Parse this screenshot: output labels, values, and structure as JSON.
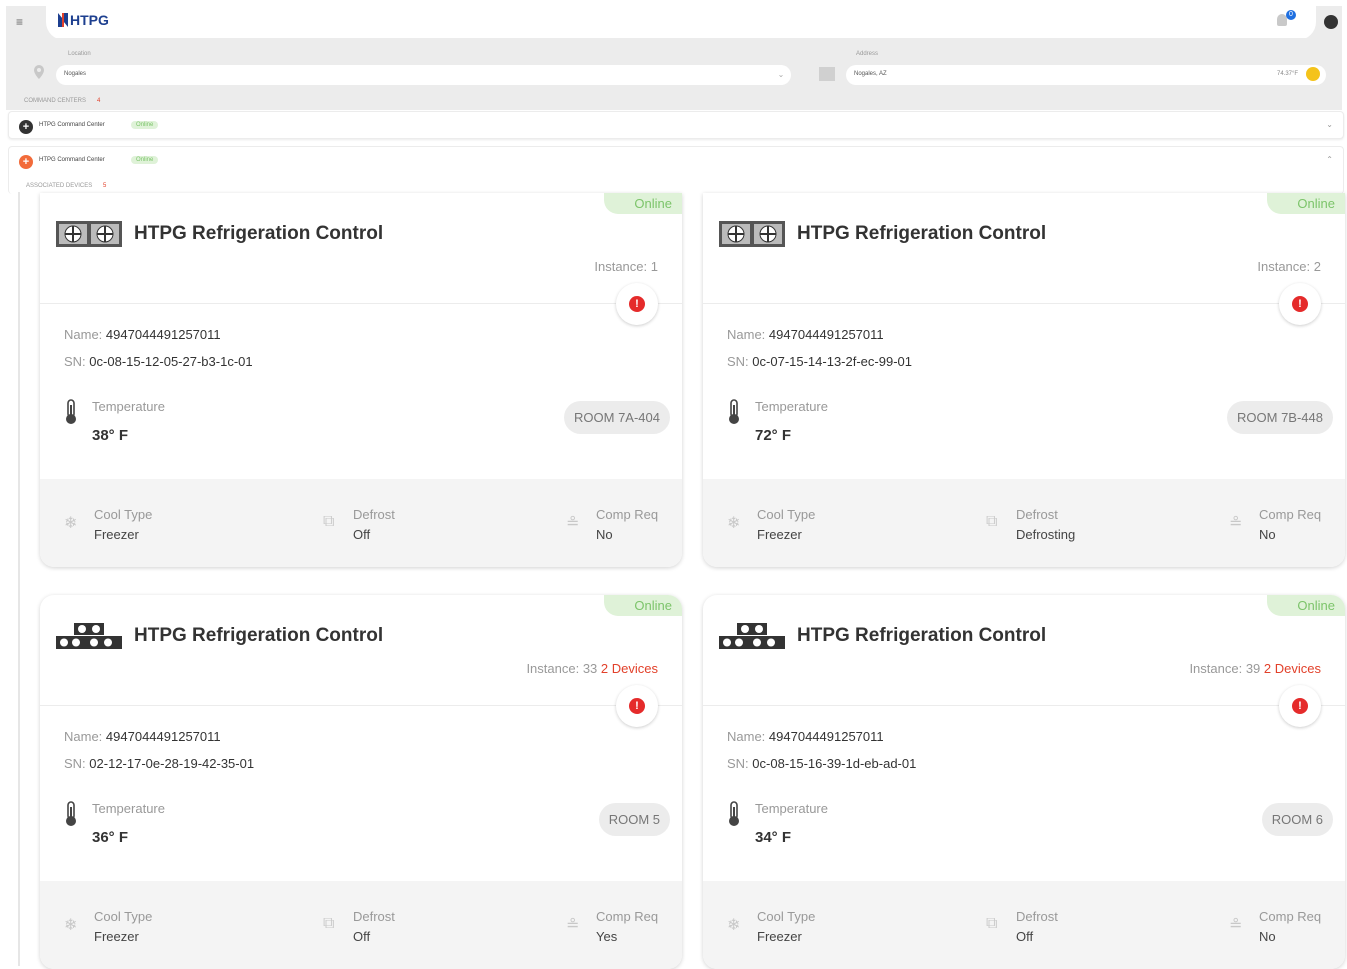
{
  "header": {
    "menu_icon": "≡",
    "logo_text": "HTPG",
    "notification_count": "0"
  },
  "filters": {
    "location_label": "Location",
    "location_value": "Nogales",
    "address_label": "Address",
    "address_value": "Nogales, AZ",
    "weather_temp": "74.37°F"
  },
  "command_centers": {
    "label": "COMMAND CENTERS",
    "count": "4",
    "rows": [
      {
        "name": "HTPG Command Center",
        "status": "Online",
        "color": "#333333",
        "icon": "+",
        "chevron": "⌄"
      },
      {
        "name": "HTPG Command Center",
        "status": "Online",
        "color": "#f26b3a",
        "icon": "+",
        "chevron": "⌃"
      }
    ],
    "associated_label": "ASSOCIATED DEVICES",
    "associated_count": "5"
  },
  "cards": [
    {
      "status": "Online",
      "title": "HTPG Refrigeration Control",
      "instance_prefix": "Instance:",
      "instance": "1",
      "devices": "",
      "name_label": "Name:",
      "name": "4947044491257011",
      "sn_label": "SN:",
      "sn": "0c-08-15-12-05-27-b3-1c-01",
      "temp_label": "Temperature",
      "temp": "38° F",
      "room": "ROOM 7A-404",
      "cool_label": "Cool Type",
      "cool": "Freezer",
      "defrost_label": "Defrost",
      "defrost": "Off",
      "comp_label": "Comp Req",
      "comp": "No",
      "icon": "dual-fan"
    },
    {
      "status": "Online",
      "title": "HTPG Refrigeration Control",
      "instance_prefix": "Instance:",
      "instance": "2",
      "devices": "",
      "name_label": "Name:",
      "name": "4947044491257011",
      "sn_label": "SN:",
      "sn": "0c-07-15-14-13-2f-ec-99-01",
      "temp_label": "Temperature",
      "temp": "72° F",
      "room": "ROOM 7B-448",
      "cool_label": "Cool Type",
      "cool": "Freezer",
      "defrost_label": "Defrost",
      "defrost": "Defrosting",
      "comp_label": "Comp Req",
      "comp": "No",
      "icon": "dual-fan"
    },
    {
      "status": "Online",
      "title": "HTPG Refrigeration Control",
      "instance_prefix": "Instance:",
      "instance": "33",
      "devices": "2 Devices",
      "name_label": "Name:",
      "name": "4947044491257011",
      "sn_label": "SN:",
      "sn": "02-12-17-0e-28-19-42-35-01",
      "temp_label": "Temperature",
      "temp": "36° F",
      "room": "ROOM 5",
      "cool_label": "Cool Type",
      "cool": "Freezer",
      "defrost_label": "Defrost",
      "defrost": "Off",
      "comp_label": "Comp Req",
      "comp": "Yes",
      "icon": "multi-fan"
    },
    {
      "status": "Online",
      "title": "HTPG Refrigeration Control",
      "instance_prefix": "Instance:",
      "instance": "39",
      "devices": "2 Devices",
      "name_label": "Name:",
      "name": "4947044491257011",
      "sn_label": "SN:",
      "sn": "0c-08-15-16-39-1d-eb-ad-01",
      "temp_label": "Temperature",
      "temp": "34° F",
      "room": "ROOM 6",
      "cool_label": "Cool Type",
      "cool": "Freezer",
      "defrost_label": "Defrost",
      "defrost": "Off",
      "comp_label": "Comp Req",
      "comp": "No",
      "icon": "multi-fan"
    }
  ],
  "colors": {
    "online_text": "#7cc46a",
    "online_bg": "#dff2d8",
    "alert": "#e52b2b",
    "accent_red": "#e2402a",
    "brand": "#1d3f8f"
  }
}
